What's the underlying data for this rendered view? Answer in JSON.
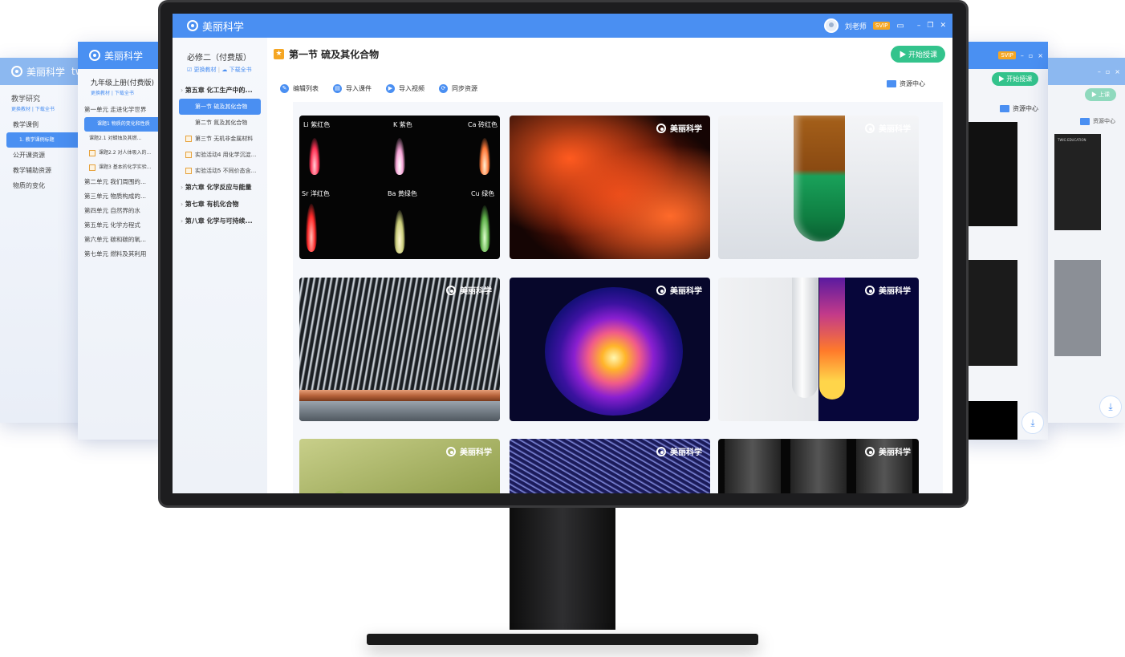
{
  "app": {
    "brand": "美丽科学",
    "user": "刘老师",
    "svip": "SVIP"
  },
  "bg_left": {
    "title_a": "美丽科学",
    "title_b": "twig",
    "nav_title": "教学研究",
    "links": "更换教材 | 下载全书",
    "items": [
      "教学课例",
      "1. 教学课例标题",
      "公开课资源",
      "教学辅助资源",
      "物质的变化"
    ]
  },
  "bg_mid": {
    "book": "九年级上册(付费版)",
    "links": "更换教材 | 下载全书",
    "items": [
      {
        "label": "第一单元 走进化学世界",
        "type": "unit"
      },
      {
        "label": "课题1 物质的变化和性质",
        "type": "active"
      },
      {
        "label": "课题2.1 对蜡烛及其燃...",
        "type": "sub"
      },
      {
        "label": "课题2.2 对人体吸入的...",
        "type": "check"
      },
      {
        "label": "课题3 基本的化学实验...",
        "type": "check"
      },
      {
        "label": "第二单元 我们周围的...",
        "type": "unit"
      },
      {
        "label": "第三单元 物质构成的...",
        "type": "unit"
      },
      {
        "label": "第四单元 自然界的水",
        "type": "unit"
      },
      {
        "label": "第五单元 化学方程式",
        "type": "unit"
      },
      {
        "label": "第六单元 碳和碳的氧...",
        "type": "unit"
      },
      {
        "label": "第七单元 燃料及其利用",
        "type": "unit"
      }
    ]
  },
  "bg_right": {
    "start": "▶ 开始授课",
    "resource": "资源中心"
  },
  "bg_far": {
    "start": "▶ 上课",
    "resource": "资源中心",
    "edu": "TWIG EDUCATION"
  },
  "sidebar": {
    "book": "必修二（付费版）",
    "change": "更换教材",
    "download": "下载全书",
    "tree": [
      {
        "label": "第五章 化工生产中的...",
        "type": "ch"
      },
      {
        "label": "第一节 硫及其化合物",
        "type": "active"
      },
      {
        "label": "第二节 氮及其化合物",
        "type": "sec"
      },
      {
        "label": "第三节 无机非金属材料",
        "type": "check"
      },
      {
        "label": "实验活动4 用化学沉淀...",
        "type": "check"
      },
      {
        "label": "实验活动5 不同价态含...",
        "type": "check"
      },
      {
        "label": "第六章 化学反应与能量",
        "type": "ch"
      },
      {
        "label": "第七章 有机化合物",
        "type": "ch"
      },
      {
        "label": "第八章 化学与可持续...",
        "type": "ch"
      }
    ]
  },
  "main": {
    "title": "第一节 硫及其化合物",
    "start": "▶ 开始授课",
    "toolbar": [
      "编辑列表",
      "导入课件",
      "导入视频",
      "同步资源"
    ],
    "resource_center": "资源中心"
  },
  "flames": {
    "labels": [
      "Li 紫红色",
      "K 紫色",
      "Ca 砖红色",
      "Sr 洋红色",
      "Ba 黄绿色",
      "Cu 绿色"
    ]
  },
  "watermark": "美丽科学",
  "colors": {
    "header": "#4a8ff2",
    "start_button": "#33c38c",
    "svip": "#f5a623"
  }
}
